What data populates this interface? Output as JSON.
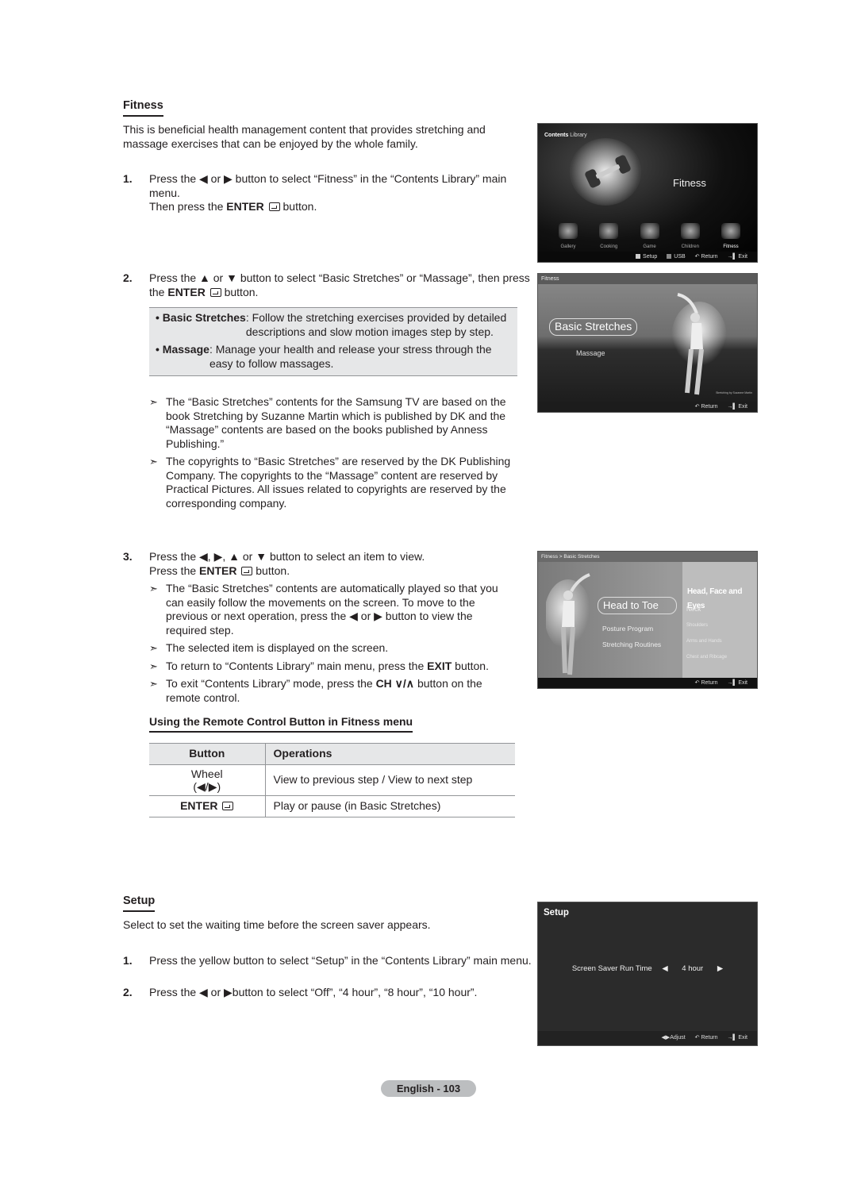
{
  "fitness": {
    "title": "Fitness",
    "intro": "This is beneficial health management content that provides stretching and massage exercises that can be enjoyed by the whole family.",
    "step1": {
      "num": "1.",
      "line1_pre": "Press the ◀ or ▶ button to select “Fitness” in the “Contents Library” main menu.",
      "line2_pre": "Then press the ",
      "enter": "ENTER",
      "line2_post": " button."
    },
    "step2": {
      "num": "2.",
      "pre": "Press the ▲ or ▼ button to select “Basic Stretches” or “Massage”, then press the ",
      "enter": "ENTER",
      "post": " button.",
      "info": [
        {
          "term": "• Basic Stretches",
          "desc": ": Follow the stretching exercises provided by detailed descriptions and slow motion images step by step."
        },
        {
          "term": "• Massage",
          "desc": ": Manage your health and release your stress through the easy to follow massages."
        }
      ],
      "notes": [
        "The “Basic Stretches” contents for the Samsung TV are based on the book Stretching by Suzanne Martin which is published by DK and the “Massage” contents are based on the books published by Anness Publishing.”",
        "The copyrights to “Basic Stretches” are reserved by the DK Publishing Company. The copyrights to the “Massage” content are reserved by Practical Pictures. All issues related to copyrights are reserved by the corresponding company."
      ]
    },
    "step3": {
      "num": "3.",
      "line1": "Press the ◀, ▶, ▲ or ▼ button to select an item to view.",
      "line2_pre": "Press the ",
      "enter": "ENTER",
      "line2_post": " button.",
      "notes": [
        "The “Basic Stretches” contents are automatically played so that you can easily follow the movements on the screen. To move to the previous or next operation, press the ◀ or ▶ button to view the required step.",
        "The selected item is displayed on the screen."
      ],
      "note_exit_pre": "To return to “Contents Library” main menu, press the ",
      "note_exit_bold": "EXIT",
      "note_exit_post": " button.",
      "note_ch_pre": "To exit “Contents Library” mode, press the ",
      "note_ch_bold": "CH ∨/∧",
      "note_ch_post": " button on the remote control."
    },
    "note_arrow": "➣",
    "remote": {
      "title": "Using the Remote Control Button in Fitness menu",
      "headers": [
        "Button",
        "Operations"
      ],
      "rows": [
        {
          "button": "Wheel",
          "button2": "(◀/▶)",
          "op": "View to previous step / View to next step"
        },
        {
          "button": "ENTER",
          "op": "Play or pause (in Basic Stretches)"
        }
      ]
    }
  },
  "setup": {
    "title": "Setup",
    "intro": "Select to set the waiting time before the screen saver appears.",
    "steps": [
      {
        "num": "1.",
        "text": "Press the yellow button to select “Setup” in the “Contents Library” main menu."
      },
      {
        "num": "2.",
        "text": "Press the ◀ or ▶button to select “Off”, “4 hour”, “8 hour”, “10 hour”."
      }
    ]
  },
  "page_label": "English - 103",
  "screens": {
    "contents_library": {
      "title_bold": "Contents",
      "title_rest": " Library",
      "selected": "Fitness",
      "icons": [
        "Gallery",
        "Cooking",
        "Game",
        "Children",
        "Fitness"
      ],
      "footer": [
        "Setup",
        "USB",
        "↶ Return",
        "→▌ Exit"
      ]
    },
    "fitness_menu": {
      "header": "Fitness",
      "selected": "Basic Stretches",
      "other": "Massage",
      "credit": "Stretching by Suzanne Martin",
      "footer": [
        "↶ Return",
        "→▌ Exit"
      ]
    },
    "basic_stretches": {
      "header": "Fitness > Basic Stretches",
      "selected": "Head to Toe",
      "options": [
        "Posture Program",
        "Stretching Routines"
      ],
      "category": "Head, Face and Eyes",
      "subitems": [
        "Neck",
        "Shoulders",
        "Arms and Hands",
        "Chest and Ribcage"
      ],
      "footer": [
        "↶ Return",
        "→▌ Exit"
      ]
    },
    "setup_screen": {
      "header": "Setup",
      "label": "Screen Saver Run Time",
      "left": "◀",
      "value": "4 hour",
      "right": "▶",
      "footer": [
        "◀▶Adjust",
        "↶ Return",
        "→▌ Exit"
      ]
    }
  }
}
